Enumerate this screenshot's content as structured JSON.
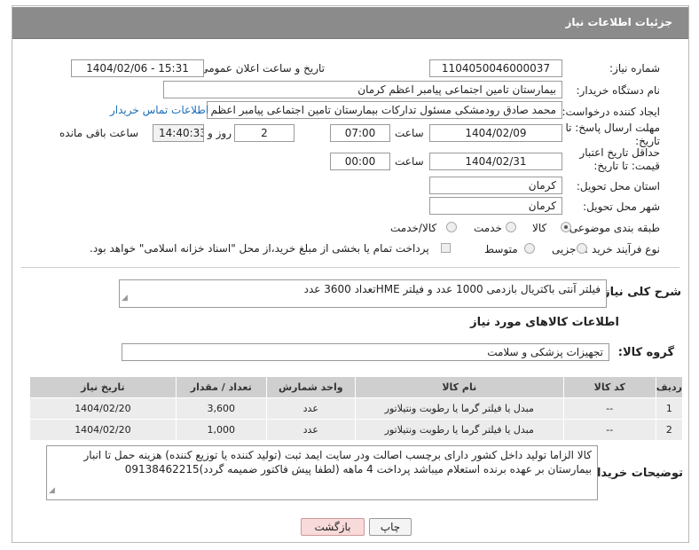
{
  "header": {
    "title": "جزئیات اطلاعات نیاز"
  },
  "fields": {
    "need_number_label": "شماره نیاز:",
    "need_number": "1104050046000037",
    "announce_label": "تاریخ و ساعت اعلان عمومی:",
    "announce_value": "1404/02/06 - 15:31",
    "buyer_org_label": "نام دستگاه خریدار:",
    "buyer_org": "بیمارستان تامین اجتماعی پیامبر اعظم کرمان",
    "creator_label": "ایجاد کننده درخواست:",
    "creator": "محمد صادق  رودمشکی مسئول تدارکات بیمارستان تامین اجتماعی پیامبر اعظم کرمان",
    "contact_link": "اطلاعات تماس خریدار",
    "deadline_label": "مهلت ارسال پاسخ: تا تاریخ:",
    "deadline_date": "1404/02/09",
    "time_label": "ساعت",
    "deadline_time": "07:00",
    "days_value": "2",
    "days_label": "روز و",
    "remaining_time": "14:40:33",
    "remaining_label": "ساعت باقی مانده",
    "min_validity_label": "حداقل تاریخ اعتبار قیمت: تا تاریخ:",
    "validity_date": "1404/02/31",
    "validity_time": "00:00",
    "province_label": "استان محل تحویل:",
    "province": "کرمان",
    "city_label": "شهر محل تحویل:",
    "city": "کرمان",
    "category_label": "طبقه بندی موضوعی:",
    "category_options": [
      "کالا",
      "خدمت",
      "کالا/خدمت"
    ],
    "process_label": "نوع فرآیند خرید :",
    "process_options": [
      "جزیی",
      "متوسط"
    ],
    "process_note": "پرداخت تمام یا بخشی از مبلغ خرید،از محل \"اسناد خزانه اسلامی\" خواهد بود."
  },
  "summary": {
    "label": "شرح کلی نیاز:",
    "text": "فیلتر آنتی باکتریال بازدمی 1000 عدد و فیلتر HMEتعداد 3600 عدد"
  },
  "goods": {
    "section_title": "اطلاعات کالاهای مورد نیاز",
    "group_label": "گروه کالا:",
    "group_value": "تجهیزات پزشکی و سلامت",
    "columns": [
      "ردیف",
      "کد کالا",
      "نام کالا",
      "واحد شمارش",
      "تعداد / مقدار",
      "تاریخ نیاز"
    ],
    "rows": [
      {
        "row": "1",
        "code": "--",
        "name": "مبدل یا فیلتر گرما یا رطوبت ونتیلاتور",
        "unit": "عدد",
        "qty": "3,600",
        "date": "1404/02/20"
      },
      {
        "row": "2",
        "code": "--",
        "name": "مبدل یا فیلتر گرما یا رطوبت ونتیلاتور",
        "unit": "عدد",
        "qty": "1,000",
        "date": "1404/02/20"
      }
    ]
  },
  "buyer_notes": {
    "label": "توضیحات خریدار:",
    "text": "کالا الزاما تولید داخل کشور دارای برچسب اصالت ودر سایت ایمد ثبت (تولید کننده یا توزیع کننده) هزینه حمل تا انبار بیمارستان بر عهده برنده استعلام میباشد پرداخت 4 ماهه (لطفا پیش فاکتور ضمیمه گردد)09138462215"
  },
  "buttons": {
    "print": "چاپ",
    "back": "بازگشت"
  }
}
